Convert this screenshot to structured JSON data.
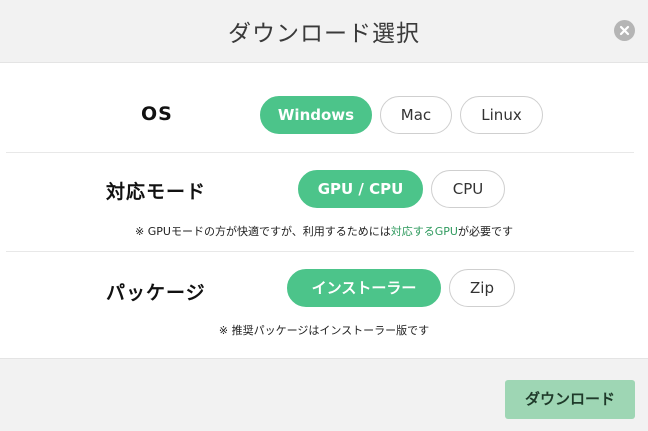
{
  "dialog": {
    "title": "ダウンロード選択",
    "close_icon": "close-icon"
  },
  "os": {
    "label": "OS",
    "options": [
      "Windows",
      "Mac",
      "Linux"
    ],
    "selected": "Windows"
  },
  "mode": {
    "label": "対応モード",
    "options": [
      "GPU / CPU",
      "CPU"
    ],
    "selected": "GPU / CPU",
    "note_prefix": "※ GPUモードの方が快適ですが、利用するためには",
    "note_link": "対応するGPU",
    "note_suffix": "が必要です"
  },
  "package": {
    "label": "パッケージ",
    "options": [
      "インストーラー",
      "Zip"
    ],
    "selected": "インストーラー",
    "note": "※ 推奨パッケージはインストーラー版です"
  },
  "footer": {
    "download_label": "ダウンロード"
  },
  "colors": {
    "accent": "#4cc48a",
    "link": "#2f9a5e",
    "download_button": "#9ed6b4"
  }
}
